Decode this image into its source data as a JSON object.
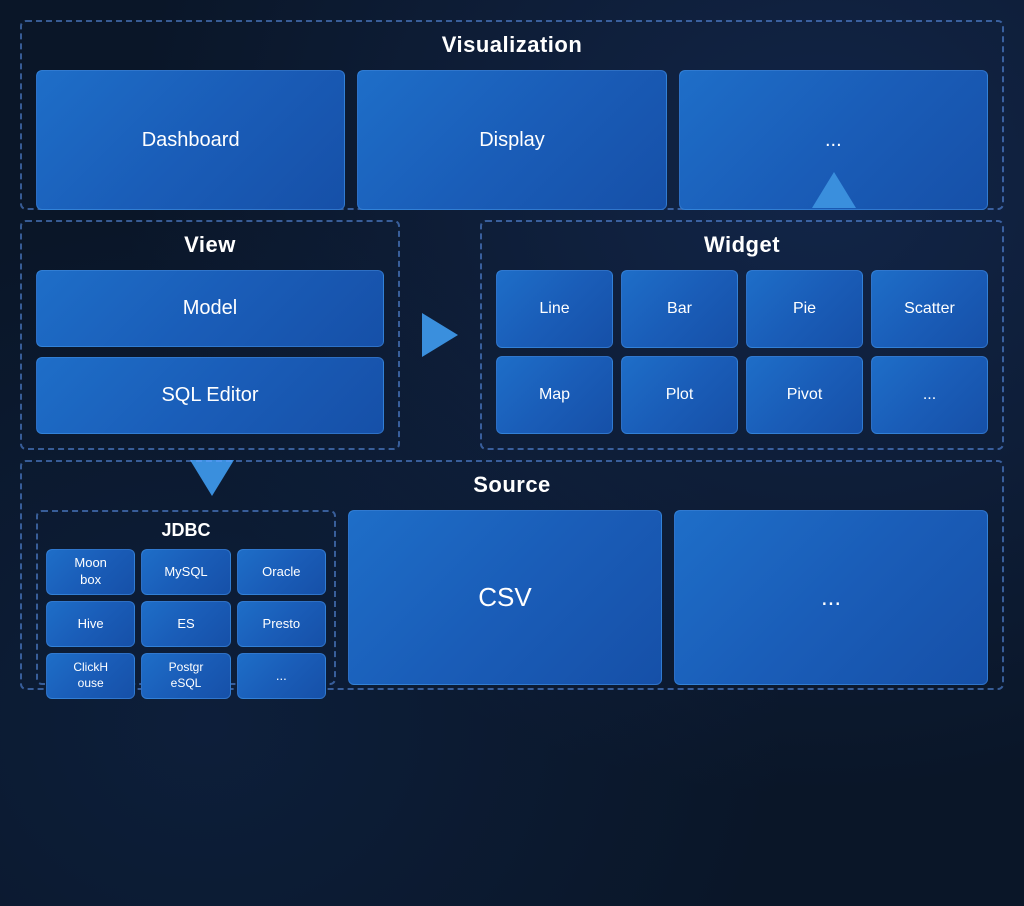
{
  "visualization": {
    "title": "Visualization",
    "cards": [
      {
        "label": "Dashboard"
      },
      {
        "label": "Display"
      },
      {
        "label": "..."
      }
    ]
  },
  "view": {
    "title": "View",
    "cards": [
      {
        "label": "Model"
      },
      {
        "label": "SQL Editor"
      }
    ]
  },
  "widget": {
    "title": "Widget",
    "cards": [
      {
        "label": "Line"
      },
      {
        "label": "Bar"
      },
      {
        "label": "Pie"
      },
      {
        "label": "Scatter"
      },
      {
        "label": "Map"
      },
      {
        "label": "Plot"
      },
      {
        "label": "Pivot"
      },
      {
        "label": "..."
      }
    ]
  },
  "source": {
    "title": "Source",
    "jdbc": {
      "title": "JDBC",
      "items": [
        {
          "label": "Moon\nbox"
        },
        {
          "label": "MySQL"
        },
        {
          "label": "Oracle"
        },
        {
          "label": "Hive"
        },
        {
          "label": "ES"
        },
        {
          "label": "Presto"
        },
        {
          "label": "ClickH\nouse"
        },
        {
          "label": "Postgr\neSQL"
        },
        {
          "label": "..."
        }
      ]
    },
    "cards": [
      {
        "label": "CSV"
      },
      {
        "label": "..."
      }
    ]
  }
}
